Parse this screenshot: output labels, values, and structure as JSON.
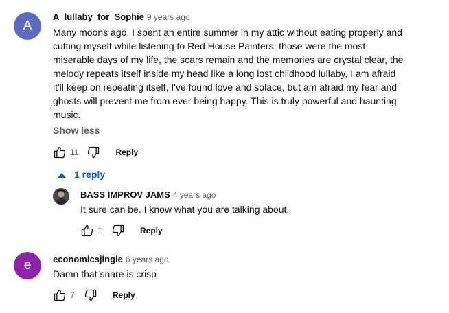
{
  "comments": [
    {
      "avatar_letter": "A",
      "avatar_color": "#5c6bc0",
      "author": "A_lullaby_for_Sophie",
      "time": "9 years ago",
      "lines": [
        "Many moons ago, I spent an entire summer in my attic without eating properly and",
        "cutting myself while listening to Red House Painters, those were the most",
        "miserable days of my life, the scars remain and the memories are crystal clear, the",
        "melody repeats itself inside my head like a long lost childhood lullaby, I am afraid",
        "it'll keep on repeating itself, I've found love and solace, but am afraid my fear and",
        "ghosts will prevent me from ever being happy. This is truly powerful and haunting",
        "music."
      ],
      "show_less": "Show less",
      "likes": "11",
      "reply_label": "Reply",
      "replies_toggle": "1 reply",
      "replies": [
        {
          "author": "BASS IMPROV JAMS",
          "time": "4 years ago",
          "text": "It sure can be. I know what you are talking about.",
          "likes": "1",
          "reply_label": "Reply"
        }
      ]
    },
    {
      "avatar_letter": "e",
      "avatar_color": "#8e24aa",
      "author": "economicsjingle",
      "time": "6 years ago",
      "text": "Damn that snare is crisp",
      "likes": "7",
      "reply_label": "Reply"
    }
  ],
  "icons": {
    "like": "thumb-up-icon",
    "dislike": "thumb-down-icon",
    "collapse": "triangle-up-icon"
  },
  "colors": {
    "link_blue": "#065fd4",
    "secondary_text": "#606060"
  }
}
